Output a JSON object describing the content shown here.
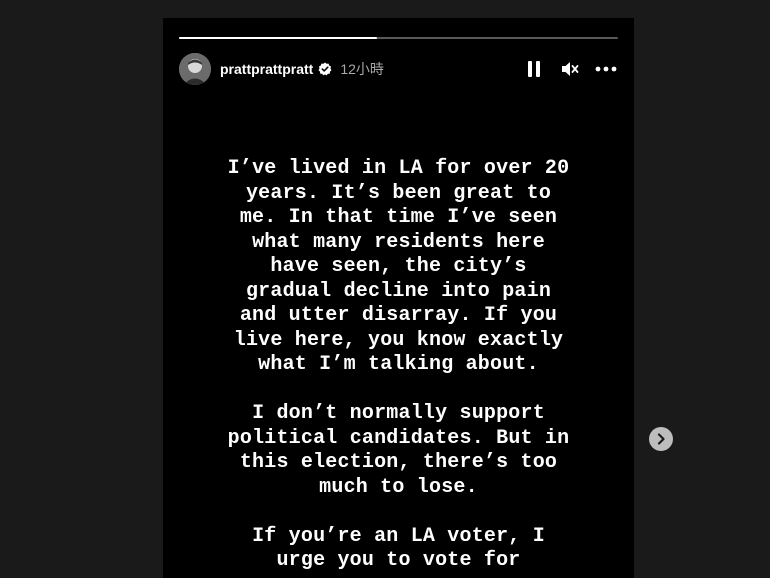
{
  "story": {
    "progress": 0.45,
    "username": "prattprattpratt",
    "timestamp": "12小時",
    "paragraphs": [
      "I’ve lived in LA for over 20\nyears. It’s been great to\nme. In that time I’ve seen\nwhat many residents here\nhave seen, the city’s\ngradual decline into pain\nand utter disarray. If you\nlive here, you know exactly\nwhat I’m talking about.",
      "I don’t normally support\npolitical candidates. But in\nthis election, there’s too\nmuch to lose.",
      "If you’re an LA voter, I\nurge you to vote for"
    ]
  },
  "icons": {
    "verified": "verified-badge-icon",
    "pause": "pause-icon",
    "mute": "muted-speaker-icon",
    "more": "more-options-icon",
    "next": "chevron-right-icon"
  },
  "colors": {
    "page_background": "#1a1a1a",
    "story_background": "#000000",
    "text": "#ffffff",
    "timestamp": "#a8a8a8"
  }
}
